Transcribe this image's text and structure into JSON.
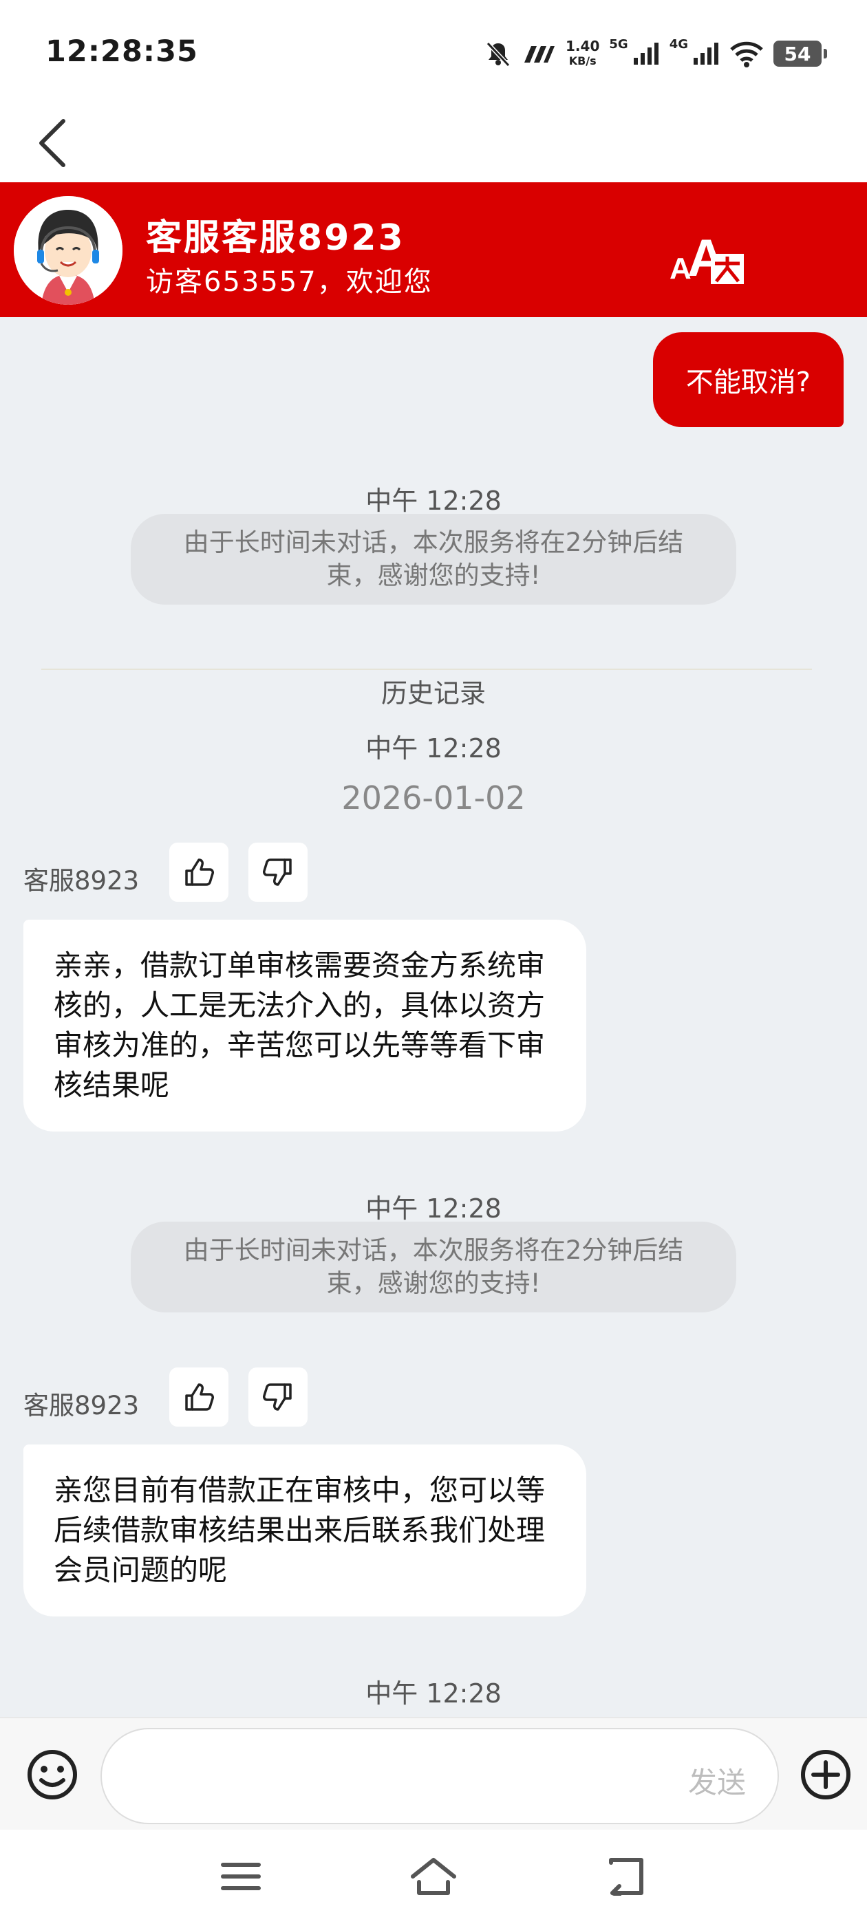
{
  "status_bar": {
    "time": "12:28:35",
    "speed_value": "1.40",
    "speed_unit": "KB/s",
    "network_5g": "5G",
    "network_4g": "4G",
    "battery": "54"
  },
  "header": {
    "title": "客服客服8923",
    "subtitle": "访客653557，欢迎您"
  },
  "messages": {
    "user_msg": "不能取消?",
    "ts1": "中午 12:28",
    "sys1": "由于长时间未对话，本次服务将在2分钟后结束，感谢您的支持!",
    "history": "历史记录",
    "ts2": "中午 12:28",
    "date": "2026-01-02",
    "agent_name1": "客服8923",
    "agent_msg1": "亲亲，借款订单审核需要资金方系统审核的，人工是无法介入的，具体以资方审核为准的，辛苦您可以先等等看下审核结果呢",
    "ts3": "中午 12:28",
    "sys2": "由于长时间未对话，本次服务将在2分钟后结束，感谢您的支持!",
    "agent_name2": "客服8923",
    "agent_msg2": "亲您目前有借款正在审核中，您可以等后续借款审核结果出来后联系我们处理会员问题的呢",
    "ts4": "中午 12:28"
  },
  "input": {
    "send_label": "发送",
    "placeholder": ""
  },
  "colors": {
    "brand_red": "#d90000",
    "chat_bg": "#edf0f3"
  }
}
